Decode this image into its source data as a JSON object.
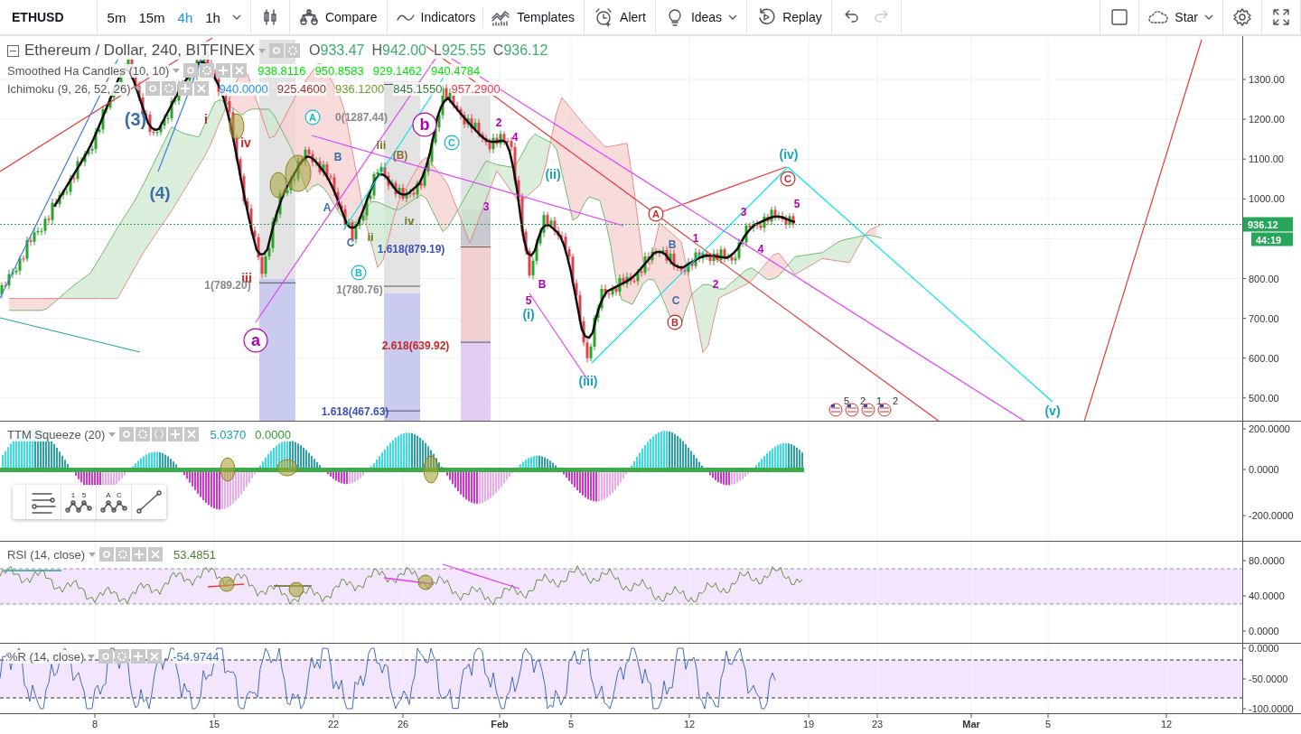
{
  "toolbar": {
    "symbol": "ETHUSD",
    "intervals": [
      {
        "label": "5m",
        "selected": false
      },
      {
        "label": "15m",
        "selected": false
      },
      {
        "label": "4h",
        "selected": true
      },
      {
        "label": "1h",
        "selected": false
      }
    ],
    "tools": [
      {
        "kind": "chart-type"
      },
      {
        "kind": "compare",
        "label": "Compare"
      },
      {
        "kind": "indicators",
        "label": "Indicators"
      },
      {
        "kind": "templates",
        "label": "Templates"
      },
      {
        "kind": "alert",
        "label": "Alert"
      },
      {
        "kind": "ideas",
        "label": "Ideas"
      },
      {
        "kind": "replay",
        "label": "Replay"
      },
      {
        "kind": "undo",
        "disabled": false
      },
      {
        "kind": "redo",
        "disabled": true
      }
    ],
    "right_tools": [
      {
        "kind": "layout"
      },
      {
        "kind": "star",
        "label": "Star"
      },
      {
        "kind": "settings"
      },
      {
        "kind": "fullscreen"
      }
    ]
  },
  "main_pane": {
    "title": "Ethereum / Dollar, 240, BITFINEX",
    "ohlc": [
      {
        "key": "O",
        "value": "933.47"
      },
      {
        "key": "H",
        "value": "942.00"
      },
      {
        "key": "L",
        "value": "925.55"
      },
      {
        "key": "C",
        "value": "936.12"
      }
    ],
    "studies": [
      {
        "title": "Smoothed Ha Candles (10, 10)",
        "values": [
          {
            "text": "938.8116",
            "color": "#00e600"
          },
          {
            "text": "950.8583",
            "color": "#00e600"
          },
          {
            "text": "929.1462",
            "color": "#00e600"
          },
          {
            "text": "940.4784",
            "color": "#00e600"
          }
        ]
      },
      {
        "title": "Ichimoku (9, 26, 52, 26)",
        "values": [
          {
            "text": "940.0000",
            "color": "#2196f3"
          },
          {
            "text": "925.4600",
            "color": "#993333"
          },
          {
            "text": "936.1200",
            "color": "#6aa121"
          },
          {
            "text": "845.1550",
            "color": "#2e7d32"
          },
          {
            "text": "957.2900",
            "color": "#f23645"
          }
        ]
      }
    ],
    "price_axis": [
      "1300.00",
      "1200.00",
      "1100.00",
      "1000.00",
      "800.00",
      "700.00",
      "600.00",
      "500.00"
    ],
    "last_price": "936.12",
    "countdown": "44:19",
    "annotations": [
      {
        "text": "(3)",
        "color": "#3d6ea8",
        "circled": false
      },
      {
        "text": "(4)",
        "color": "#3d6ea8",
        "circled": false
      },
      {
        "text": "i",
        "color": "#c62828",
        "circled": false
      },
      {
        "text": "iv",
        "color": "#c62828",
        "circled": false
      },
      {
        "text": "iii",
        "color": "#c62828",
        "circled": false
      },
      {
        "text": "a",
        "color": "#b000b0",
        "circled": true
      },
      {
        "text": "b",
        "color": "#b000b0",
        "circled": true
      },
      {
        "text": "A",
        "color": "#17b8c8",
        "circled": true
      },
      {
        "text": "B",
        "color": "#3d6ea8",
        "circled": false
      },
      {
        "text": "A",
        "color": "#3d6ea8",
        "circled": false
      },
      {
        "text": "C",
        "color": "#3d6ea8",
        "circled": false
      },
      {
        "text": "B",
        "color": "#17b8c8",
        "circled": true
      },
      {
        "text": "iii",
        "color": "#6b7a1a",
        "circled": false
      },
      {
        "text": "ii",
        "color": "#6b7a1a",
        "circled": false
      },
      {
        "text": "iv",
        "color": "#6b7a1a",
        "circled": false
      },
      {
        "text": "(B)",
        "color": "#8a6a3a",
        "circled": false
      },
      {
        "text": "C",
        "color": "#17b8c8",
        "circled": true
      },
      {
        "text": "1(789.20)",
        "color": "#888888",
        "circled": false
      },
      {
        "text": "0(1287.44)",
        "color": "#888888",
        "circled": false
      },
      {
        "text": "1.618(879.19)",
        "color": "#3f51b5",
        "circled": false
      },
      {
        "text": "1(780.76)",
        "color": "#888888",
        "circled": false
      },
      {
        "text": "2.618(639.92)",
        "color": "#c62828",
        "circled": false
      },
      {
        "text": "1.618(467.63)",
        "color": "#3f51b5",
        "circled": false
      },
      {
        "text": "2",
        "color": "#b000b0",
        "circled": false
      },
      {
        "text": "4",
        "color": "#b000b0",
        "circled": false
      },
      {
        "text": "3",
        "color": "#b000b0",
        "circled": false
      },
      {
        "text": "5",
        "color": "#b000b0",
        "circled": false
      },
      {
        "text": "B",
        "color": "#b000b0",
        "circled": false
      },
      {
        "text": "(i)",
        "color": "#17a2b8",
        "circled": false
      },
      {
        "text": "(ii)",
        "color": "#17a2b8",
        "circled": false
      },
      {
        "text": "(iii)",
        "color": "#17a2b8",
        "circled": false
      },
      {
        "text": "A",
        "color": "#c62828",
        "circled": true
      },
      {
        "text": "B",
        "color": "#3d6ea8",
        "circled": false
      },
      {
        "text": "C",
        "color": "#3d6ea8",
        "circled": false
      },
      {
        "text": "B",
        "color": "#c62828",
        "circled": true
      },
      {
        "text": "1",
        "color": "#b000b0",
        "circled": false
      },
      {
        "text": "2",
        "color": "#b000b0",
        "circled": false
      },
      {
        "text": "3",
        "color": "#b000b0",
        "circled": false
      },
      {
        "text": "4",
        "color": "#b000b0",
        "circled": false
      },
      {
        "text": "5",
        "color": "#b000b0",
        "circled": false
      },
      {
        "text": "C",
        "color": "#c62828",
        "circled": true
      },
      {
        "text": "(iv)",
        "color": "#17a2b8",
        "circled": false
      },
      {
        "text": "(v)",
        "color": "#17a2b8",
        "circled": false
      }
    ],
    "events": [
      "5",
      "2",
      "1",
      "2"
    ]
  },
  "ttm_pane": {
    "title": "TTM Squeeze (20)",
    "values": [
      {
        "text": "5.0370",
        "color": "#1aa3a3"
      },
      {
        "text": "0.0000",
        "color": "#2e9e2e"
      }
    ],
    "axis": [
      "200.0000",
      "0.0000",
      "-200.0000"
    ]
  },
  "drawing_tools": [
    {
      "kind": "fib"
    },
    {
      "kind": "impulse",
      "marks": [
        "1",
        "5"
      ]
    },
    {
      "kind": "correction",
      "marks": [
        "A",
        "C"
      ]
    },
    {
      "kind": "line"
    }
  ],
  "rsi_pane": {
    "title": "RSI (14, close)",
    "values": [
      {
        "text": "53.4851",
        "color": "#4a7f2a"
      }
    ],
    "axis": [
      "80.0000",
      "40.0000",
      "0.0000"
    ]
  },
  "wr_pane": {
    "title": "%R (14, close)",
    "values": [
      {
        "text": "-54.9744",
        "color": "#3f6fbf"
      }
    ],
    "axis": [
      "0.0000",
      "-50.0000",
      "-100.0000"
    ]
  },
  "time_axis": [
    {
      "label": "8",
      "kind": "day"
    },
    {
      "label": "15",
      "kind": "day"
    },
    {
      "label": "22",
      "kind": "day"
    },
    {
      "label": "26",
      "kind": "day"
    },
    {
      "label": "Feb",
      "kind": "month"
    },
    {
      "label": "5",
      "kind": "day"
    },
    {
      "label": "12",
      "kind": "day"
    },
    {
      "label": "19",
      "kind": "day"
    },
    {
      "label": "23",
      "kind": "day"
    },
    {
      "label": "Mar",
      "kind": "month"
    },
    {
      "label": "5",
      "kind": "day"
    },
    {
      "label": "12",
      "kind": "day"
    }
  ]
}
